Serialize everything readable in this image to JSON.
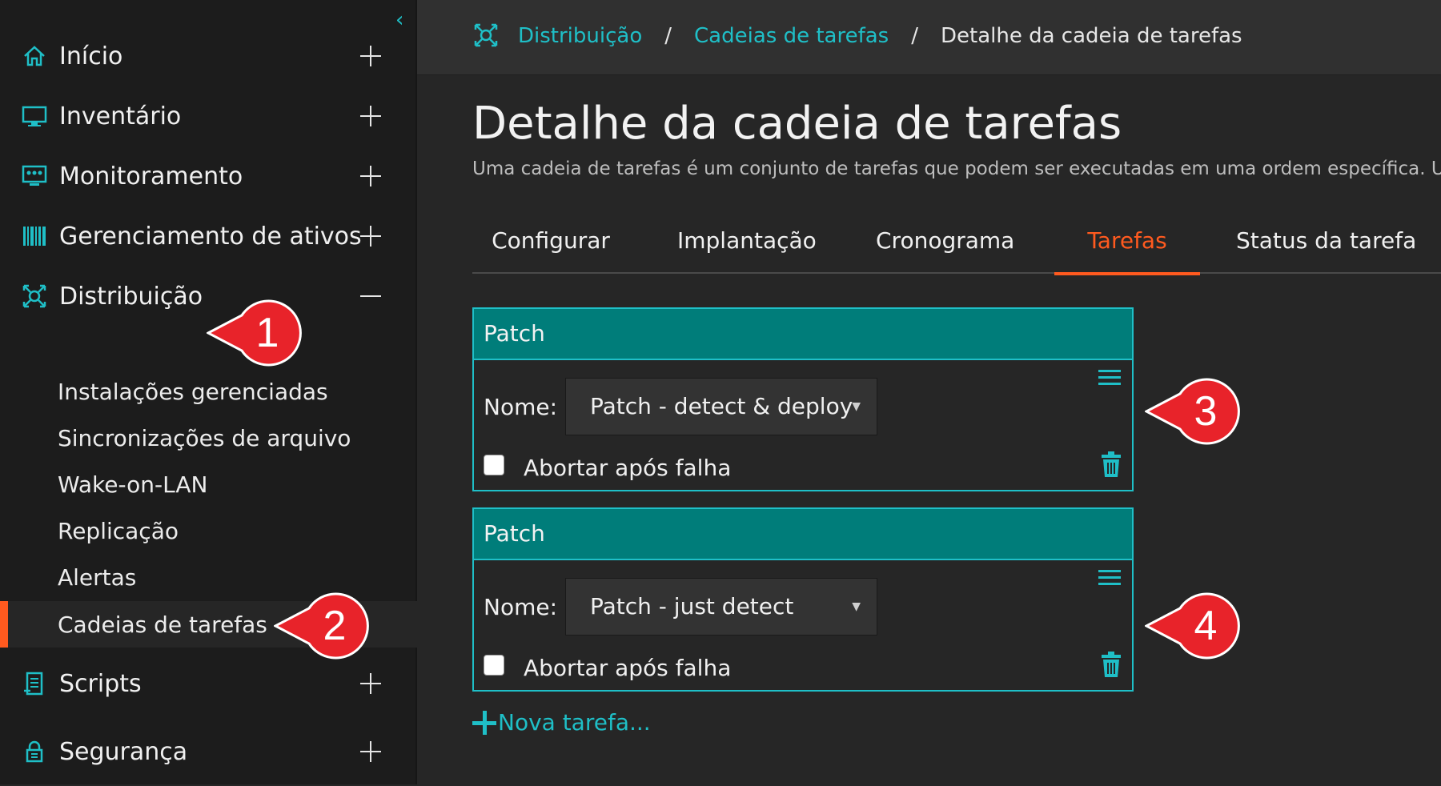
{
  "sidebar": {
    "nav": [
      {
        "label": "Início",
        "icon": "home-icon",
        "state": "collapsed"
      },
      {
        "label": "Inventário",
        "icon": "monitor-icon",
        "state": "collapsed"
      },
      {
        "label": "Monitoramento",
        "icon": "monitoring-icon",
        "state": "collapsed"
      },
      {
        "label": "Gerenciamento de ativos",
        "icon": "barcode-icon",
        "state": "collapsed"
      },
      {
        "label": "Distribuição",
        "icon": "distribution-icon",
        "state": "expanded"
      },
      {
        "label": "Scripts",
        "icon": "script-icon",
        "state": "collapsed"
      },
      {
        "label": "Segurança",
        "icon": "lock-icon",
        "state": "collapsed"
      }
    ],
    "sub_items": [
      {
        "label": "Instalações gerenciadas"
      },
      {
        "label": "Sincronizações de arquivo"
      },
      {
        "label": "Wake-on-LAN"
      },
      {
        "label": "Replicação"
      },
      {
        "label": "Alertas"
      },
      {
        "label": "Cadeias de tarefas",
        "active": true
      }
    ]
  },
  "breadcrumb": {
    "items": [
      "Distribuição",
      "Cadeias de tarefas"
    ],
    "current": "Detalhe da cadeia de tarefas",
    "separator": "/"
  },
  "page": {
    "title": "Detalhe da cadeia de tarefas",
    "description": "Uma cadeia de tarefas é um conjunto de tarefas que podem ser executadas em uma ordem específica. Use a"
  },
  "tabs": [
    {
      "label": "Configurar"
    },
    {
      "label": "Implantação"
    },
    {
      "label": "Cronograma"
    },
    {
      "label": "Tarefas",
      "active": true
    },
    {
      "label": "Status da tarefa"
    }
  ],
  "tasks": [
    {
      "header": "Patch",
      "name_label": "Nome:",
      "selected": "Patch - detect & deploy",
      "abort_label": "Abortar após falha",
      "abort_checked": false
    },
    {
      "header": "Patch",
      "name_label": "Nome:",
      "selected": "Patch - just detect",
      "abort_label": "Abortar após falha",
      "abort_checked": false
    }
  ],
  "new_task_label": "Nova tarefa...",
  "callouts": [
    "1",
    "2",
    "3",
    "4"
  ],
  "colors": {
    "accent": "#1fbfc7",
    "active": "#ff5a1f",
    "task_header": "#007d7a",
    "callout": "#e8232a"
  }
}
